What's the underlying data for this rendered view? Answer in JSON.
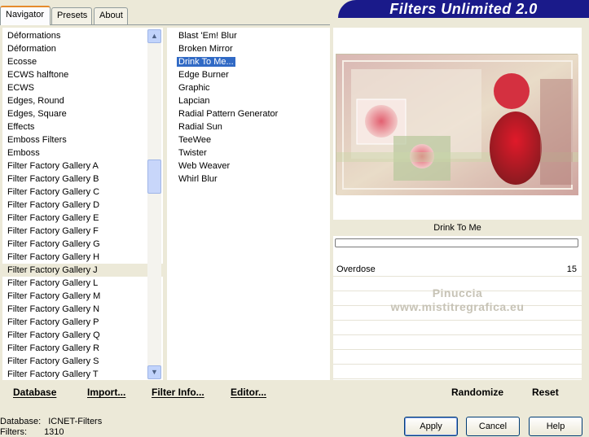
{
  "tabs": [
    "Navigator",
    "Presets",
    "About"
  ],
  "banner_title": "Filters Unlimited 2.0",
  "categories": [
    "Déformations",
    "Déformation",
    "Ecosse",
    "ECWS halftone",
    "ECWS",
    "Edges, Round",
    "Edges, Square",
    "Effects",
    "Emboss Filters",
    "Emboss",
    "Filter Factory Gallery A",
    "Filter Factory Gallery B",
    "Filter Factory Gallery C",
    "Filter Factory Gallery D",
    "Filter Factory Gallery E",
    "Filter Factory Gallery F",
    "Filter Factory Gallery G",
    "Filter Factory Gallery H",
    "Filter Factory Gallery J",
    "Filter Factory Gallery L",
    "Filter Factory Gallery M",
    "Filter Factory Gallery N",
    "Filter Factory Gallery P",
    "Filter Factory Gallery Q",
    "Filter Factory Gallery R",
    "Filter Factory Gallery S",
    "Filter Factory Gallery T"
  ],
  "selected_category": "Filter Factory Gallery J",
  "filters": [
    "Blast 'Em! Blur",
    "Broken Mirror",
    "Drink To Me...",
    "Edge Burner",
    "Graphic",
    "Lapcian",
    "Radial Pattern Generator",
    "Radial Sun",
    "TeeWee",
    "Twister",
    "Web Weaver",
    "Whirl Blur"
  ],
  "selected_filter": "Drink To Me...",
  "filter_caption": "Drink To Me",
  "parameters": [
    {
      "name": "Overdose",
      "value": "15"
    }
  ],
  "watermark": {
    "line1": "Pinuccia",
    "line2": "www.mistitregrafica.eu"
  },
  "bottom_links": {
    "database": "Database",
    "import": "Import...",
    "filter_info": "Filter Info...",
    "editor": "Editor...",
    "randomize": "Randomize",
    "reset": "Reset"
  },
  "status": {
    "database_label": "Database:",
    "database_value": "ICNET-Filters",
    "filters_label": "Filters:",
    "filters_value": "1310"
  },
  "buttons": {
    "apply": "Apply",
    "cancel": "Cancel",
    "help": "Help"
  },
  "colors": {
    "banner": "#1a1a8a",
    "selection": "#316ac5",
    "dialog_bg": "#ece9d8"
  }
}
